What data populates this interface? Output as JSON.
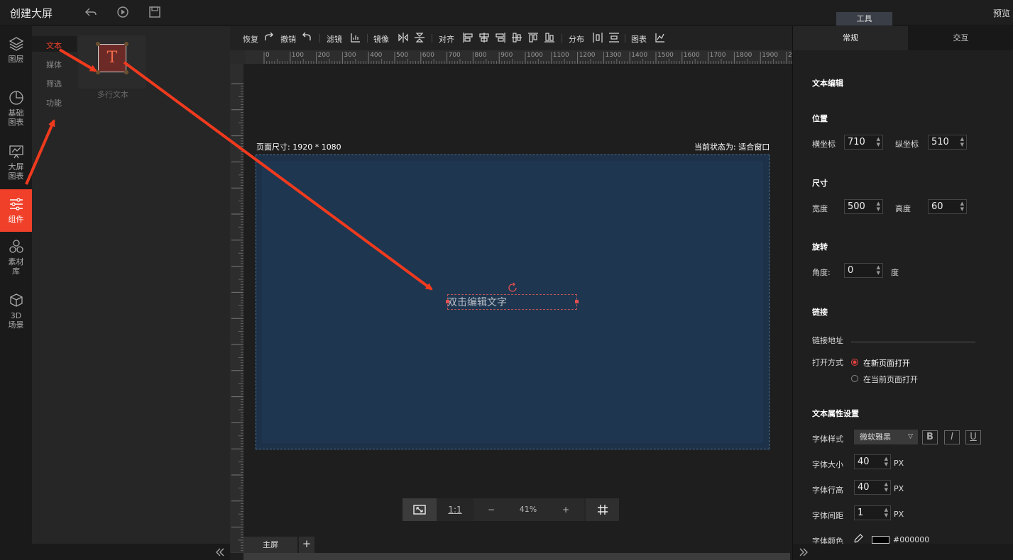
{
  "app": {
    "title": "创建大屏",
    "tools_tab": "工具",
    "preview": "预览"
  },
  "leftnav": {
    "items": [
      {
        "label": "图层",
        "icon": "layers-icon"
      },
      {
        "label": "基础图表",
        "icon": "pie-chart-icon"
      },
      {
        "label": "大屏图表",
        "icon": "presentation-chart-icon"
      },
      {
        "label": "组件",
        "icon": "sliders-icon",
        "active": true
      },
      {
        "label": "素材库",
        "icon": "hexagons-icon"
      },
      {
        "label": "3D场景",
        "icon": "cube-icon"
      }
    ]
  },
  "panel": {
    "categories": [
      "文本",
      "媒体",
      "筛选",
      "功能"
    ],
    "active_category": "文本",
    "component": {
      "glyph": "T",
      "label": "多行文本"
    }
  },
  "toolbar": {
    "redo": "恢复",
    "undo": "撤销",
    "filter": "滤镜",
    "mirror": "镜像",
    "align": "对齐",
    "distribute": "分布",
    "chart": "图表"
  },
  "ruler": {
    "ticks": [
      "0",
      "100",
      "200",
      "300",
      "400",
      "500",
      "600",
      "700",
      "800",
      "900",
      "1000",
      "1100",
      "1200",
      "1300",
      "1400",
      "1500",
      "1600",
      "1700",
      "1800",
      "1900",
      "20"
    ]
  },
  "canvas": {
    "page_size": "页面尺寸: 1920 * 1080",
    "state": "当前状态为: 适合窗口",
    "text_placeholder": "双击编辑文字"
  },
  "zoombar": {
    "ratio": "1:1",
    "minus": "−",
    "zoom": "41%",
    "plus": "+"
  },
  "tabs": {
    "main": "主屏",
    "add": "+"
  },
  "props": {
    "tab_general": "常规",
    "tab_interact": "交互",
    "text_edit": "文本编辑",
    "position": "位置",
    "x_label": "横坐标",
    "x_value": "710",
    "y_label": "纵坐标",
    "y_value": "510",
    "size": "尺寸",
    "width_label": "宽度",
    "width_value": "500",
    "height_label": "高度",
    "height_value": "60",
    "rotate": "旋转",
    "angle_label": "角度:",
    "angle_value": "0",
    "angle_unit": "度",
    "link": "链接",
    "link_addr": "链接地址",
    "open_mode": "打开方式",
    "open_new": "在新页面打开",
    "open_current": "在当前页面打开",
    "text_attrs": "文本属性设置",
    "font_style_label": "字体样式",
    "font_style_value": "微软雅黑",
    "bold": "B",
    "italic": "I",
    "underline": "U",
    "font_size_label": "字体大小",
    "font_size_value": "40",
    "line_height_label": "字体行高",
    "line_height_value": "40",
    "spacing_label": "字体间距",
    "spacing_value": "1",
    "px": "PX",
    "color_label": "字体颜色",
    "color_value": "#000000"
  }
}
